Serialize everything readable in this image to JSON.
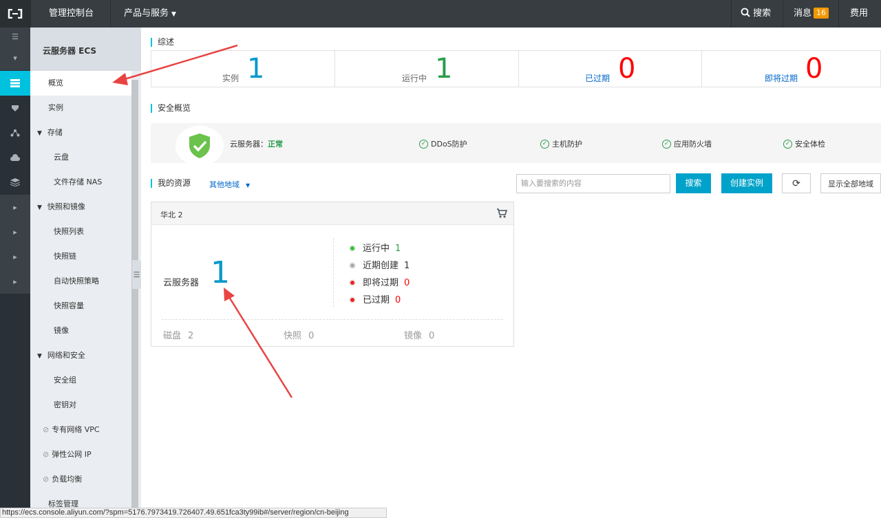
{
  "topbar": {
    "console_label": "管理控制台",
    "products_label": "产品与服务",
    "search_label": "搜索",
    "messages_label": "消息",
    "messages_count": "16",
    "billing_label": "费用"
  },
  "sidebar": {
    "title": "云服务器 ECS",
    "items": [
      {
        "label": "概览"
      },
      {
        "label": "实例"
      },
      {
        "label": "存储"
      },
      {
        "label": "云盘"
      },
      {
        "label": "文件存储 NAS"
      },
      {
        "label": "快照和镜像"
      },
      {
        "label": "快照列表"
      },
      {
        "label": "快照链"
      },
      {
        "label": "自动快照策略"
      },
      {
        "label": "快照容量"
      },
      {
        "label": "镜像"
      },
      {
        "label": "网络和安全"
      },
      {
        "label": "安全组"
      },
      {
        "label": "密钥对"
      },
      {
        "label": "专有网络 VPC"
      },
      {
        "label": "弹性公网 IP"
      },
      {
        "label": "负载均衡"
      },
      {
        "label": "标签管理"
      }
    ]
  },
  "overview": {
    "section_title": "综述",
    "cards": [
      {
        "label": "实例",
        "value": "1"
      },
      {
        "label": "运行中",
        "value": "1"
      },
      {
        "label": "已过期",
        "value": "0"
      },
      {
        "label": "即将过期",
        "value": "0"
      }
    ]
  },
  "security": {
    "section_title": "安全概览",
    "server_label": "云服务器：",
    "server_status": "正常",
    "items": [
      "DDoS防护",
      "主机防护",
      "应用防火墙",
      "安全体检"
    ]
  },
  "resources": {
    "section_title": "我的资源",
    "region_filter": "其他地域",
    "search_placeholder": "输入要搜索的内容",
    "search_button": "搜索",
    "create_button": "创建实例",
    "show_all_button": "显示全部地域"
  },
  "region_card": {
    "region": "华北 2",
    "service_label": "云服务器",
    "service_count": "1",
    "statuses": [
      {
        "label": "运行中",
        "value": "1"
      },
      {
        "label": "近期创建",
        "value": "1"
      },
      {
        "label": "即将过期",
        "value": "0"
      },
      {
        "label": "已过期",
        "value": "0"
      }
    ],
    "footer": [
      {
        "label": "磁盘",
        "value": "2"
      },
      {
        "label": "快照",
        "value": "0"
      },
      {
        "label": "镜像",
        "value": "0"
      }
    ]
  },
  "status_bar": {
    "url": "https://ecs.console.aliyun.com/?spm=5176.7973419.726407.49.651fca3ty99ib#/server/region/cn-beijing"
  },
  "colors": {
    "accent": "#00c1de",
    "blue_value": "#0099cc",
    "green_value": "#2a9d4b",
    "red_value": "#ff0000",
    "link": "#0066cc",
    "badge": "#f39800",
    "arrow": "#e94343"
  },
  "icons": [
    "logo-icon",
    "caret-down-icon",
    "search-icon",
    "menu-icon",
    "shield-icon",
    "check-circle-icon",
    "cart-icon",
    "refresh-icon",
    "link-icon",
    "chevron-right-icon",
    "collapse-icon"
  ]
}
